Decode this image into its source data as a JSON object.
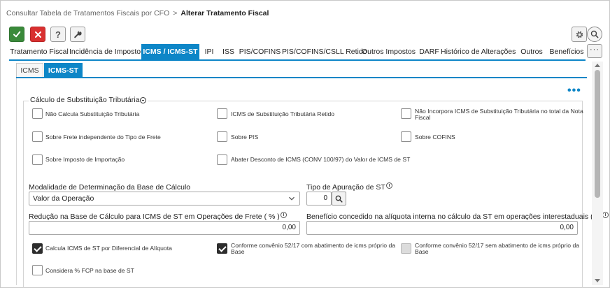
{
  "breadcrumb": {
    "parent": "Consultar Tabela de Tratamentos Fiscais por CFO",
    "separator": ">",
    "current": "Alterar Tratamento Fiscal"
  },
  "toolbar": {
    "help_label": "?",
    "icons": [
      "check-icon",
      "close-icon",
      "help-icon",
      "wrench-icon",
      "gear-icon",
      "search-icon",
      "more-icon"
    ]
  },
  "main_tabs": [
    "Tratamento Fiscal",
    "Incidência de Impostos",
    "ICMS / ICMS-ST",
    "IPI",
    "ISS",
    "PIS/COFINS",
    "PIS/COFINS/CSLL Retido",
    "Outros Impostos",
    "DARF",
    "Histórico de Alterações",
    "Outros",
    "Benefícios"
  ],
  "active_main_tab": "ICMS / ICMS-ST",
  "more_tabs_label": "···",
  "sub_tabs": [
    "ICMS",
    "ICMS-ST"
  ],
  "active_sub_tab": "ICMS-ST",
  "options_menu_label": "•••",
  "section": {
    "title": "Cálculo de Substituição Tributária",
    "checkboxes": {
      "nao_calcula_st": {
        "label": "Não Calcula Substituição Tributária",
        "checked": false
      },
      "icms_st_retido": {
        "label": "ICMS de Substituição Tributária Retido",
        "checked": false
      },
      "nao_incorpora_line1": "Não Incorpora ICMS de Substituição Tributária no total da Nota",
      "nao_incorpora_line2": "Fiscal",
      "nao_incorpora_checked": false,
      "sobre_frete": {
        "label": "Sobre Frete independente do Tipo de Frete",
        "checked": false
      },
      "sobre_pis": {
        "label": "Sobre PIS",
        "checked": false
      },
      "sobre_cofins": {
        "label": "Sobre COFINS",
        "checked": false
      },
      "sobre_importacao": {
        "label": "Sobre Imposto de Importação",
        "checked": false
      },
      "abater_desconto": {
        "label": "Abater Desconto de ICMS (CONV 100/97) do Valor de ICMS de ST",
        "checked": false
      }
    }
  },
  "fields": {
    "modalidade": {
      "label": "Modalidade de Determinação da Base de Cálculo",
      "value": "Valor da Operação"
    },
    "tipo_apuracao": {
      "label": "Tipo de Apuração de ST",
      "value": "0"
    },
    "reducao_frete": {
      "label": "Redução na Base de Cálculo para ICMS de ST em Operações de Frete ( % )",
      "value": "0,00"
    },
    "beneficio": {
      "label": "Benefício concedido na alíquota interna no cálculo da ST em operações interestaduais (%)",
      "value": "0,00"
    }
  },
  "bottom_checkboxes": {
    "diferencial": {
      "label": "Calcula ICMS de ST por Diferencial de Alíquota",
      "checked": true
    },
    "conv_com_line1": "Conforme convênio 52/17 com abatimento de icms próprio da",
    "conv_com_line2": "Base",
    "conv_com_checked": true,
    "conv_sem_line1": "Conforme convênio 52/17 sem abatimento de icms próprio da",
    "conv_sem_line2": "Base",
    "conv_sem_checked": false,
    "conv_sem_disabled": true,
    "fcp": {
      "label": "Considera % FCP na base de ST",
      "checked": false
    }
  },
  "colors": {
    "accent": "#0d86c7",
    "ok_button": "#3a8a3a",
    "cancel_button": "#d93030"
  }
}
